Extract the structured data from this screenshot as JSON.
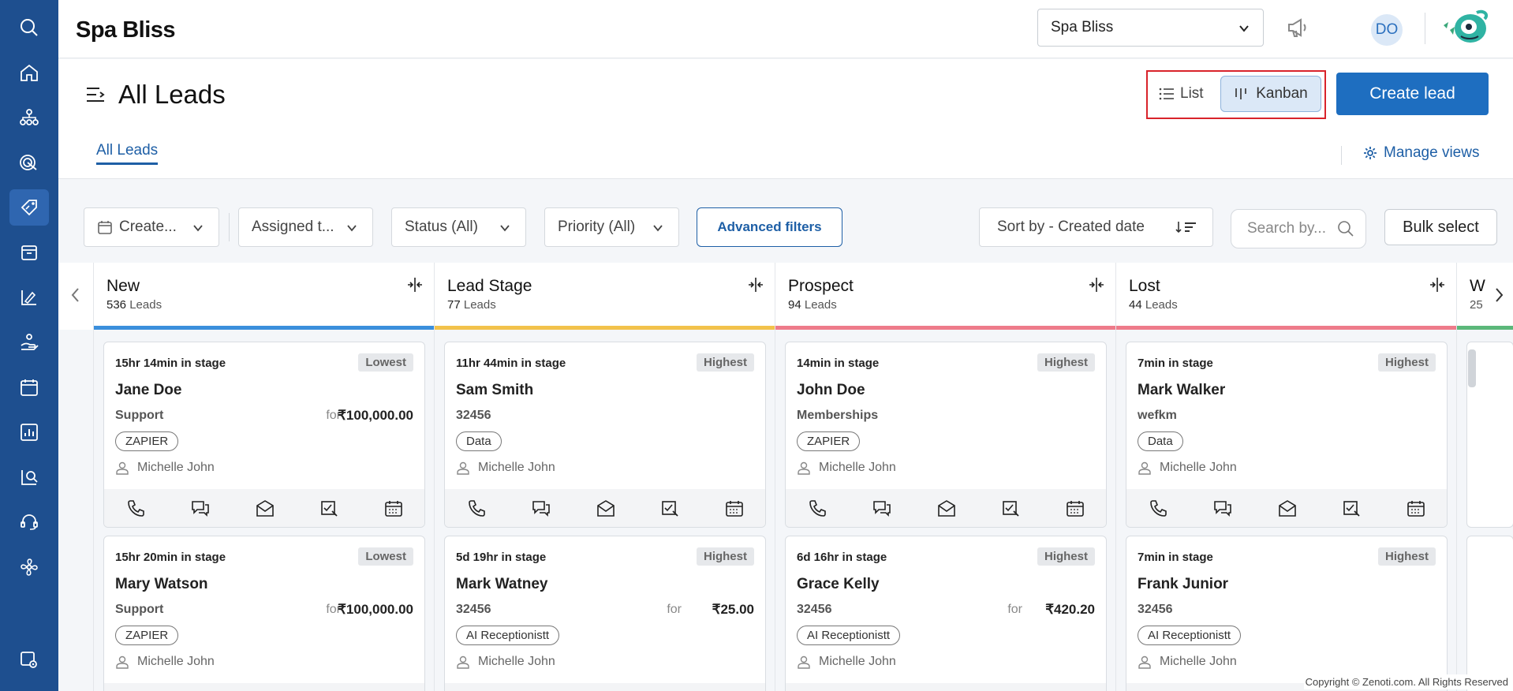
{
  "header": {
    "brand": "Spa Bliss",
    "org_select": "Spa Bliss",
    "avatar_initials": "DO"
  },
  "page": {
    "title": "All Leads",
    "view_list": "List",
    "view_kanban": "Kanban",
    "create_button": "Create lead",
    "tab_all": "All Leads",
    "manage_views": "Manage views"
  },
  "filters": {
    "created": "Create...",
    "assigned": "Assigned t...",
    "status": "Status (All)",
    "priority": "Priority (All)",
    "advanced": "Advanced filters",
    "sort": "Sort by - Created date",
    "search_placeholder": "Search by...",
    "bulk_select": "Bulk select"
  },
  "colors": {
    "sidebar": "#1e4f8f",
    "primary": "#1e6ec0",
    "new": "#3b8fdc",
    "lead_stage": "#f2c24b",
    "prospect": "#ee7b8a",
    "lost": "#ee7b8a"
  },
  "columns": [
    {
      "name": "New",
      "count": "536",
      "count_suffix": "Leads",
      "cards": [
        {
          "stage": "15hr 14min in stage",
          "priority": "Lowest",
          "name": "Jane Doe",
          "sub": "Support",
          "for": "for",
          "amount": "₹100,000.00",
          "tag": "ZAPIER",
          "owner": "Michelle John"
        },
        {
          "stage": "15hr 20min in stage",
          "priority": "Lowest",
          "name": "Mary Watson",
          "sub": "Support",
          "for": "for",
          "amount": "₹100,000.00",
          "tag": "ZAPIER",
          "owner": "Michelle John"
        }
      ]
    },
    {
      "name": "Lead Stage",
      "count": "77",
      "count_suffix": "Leads",
      "cards": [
        {
          "stage": "11hr 44min in stage",
          "priority": "Highest",
          "name": "Sam Smith",
          "sub": "32456",
          "for": "",
          "amount": "",
          "tag": "Data",
          "owner": "Michelle John"
        },
        {
          "stage": "5d 19hr in stage",
          "priority": "Highest",
          "name": "Mark Watney",
          "sub": "32456",
          "for": "for",
          "amount": "₹25.00",
          "tag": "AI Receptionistt",
          "owner": "Michelle John"
        }
      ]
    },
    {
      "name": "Prospect",
      "count": "94",
      "count_suffix": "Leads",
      "cards": [
        {
          "stage": "14min in stage",
          "priority": "Highest",
          "name": "John Doe",
          "sub": "Memberships",
          "for": "",
          "amount": "",
          "tag": "ZAPIER",
          "owner": "Michelle John"
        },
        {
          "stage": "6d 16hr in stage",
          "priority": "Highest",
          "name": "Grace Kelly",
          "sub": "32456",
          "for": "for",
          "amount": "₹420.20",
          "tag": "AI Receptionistt",
          "owner": "Michelle John"
        }
      ]
    },
    {
      "name": "Lost",
      "count": "44",
      "count_suffix": "Leads",
      "cards": [
        {
          "stage": "7min in stage",
          "priority": "Highest",
          "name": "Mark Walker",
          "sub": "wefkm",
          "for": "",
          "amount": "",
          "tag": "Data",
          "owner": "Michelle John"
        },
        {
          "stage": "7min in stage",
          "priority": "Highest",
          "name": "Frank Junior",
          "sub": "32456",
          "for": "",
          "amount": "",
          "tag": "AI Receptionistt",
          "owner": "Michelle John"
        }
      ]
    }
  ],
  "peek_column": {
    "name": "W",
    "count": "25"
  },
  "sidebar_icons": [
    "search-icon",
    "home-icon",
    "org-icon",
    "target-icon",
    "tag-icon",
    "box-icon",
    "chart-edit-icon",
    "hand-icon",
    "calendar-icon",
    "report-icon",
    "analytics-icon",
    "support-icon",
    "fan-icon",
    "settings-icon"
  ],
  "footer": "Copyright © Zenoti.com. All Rights Reserved"
}
